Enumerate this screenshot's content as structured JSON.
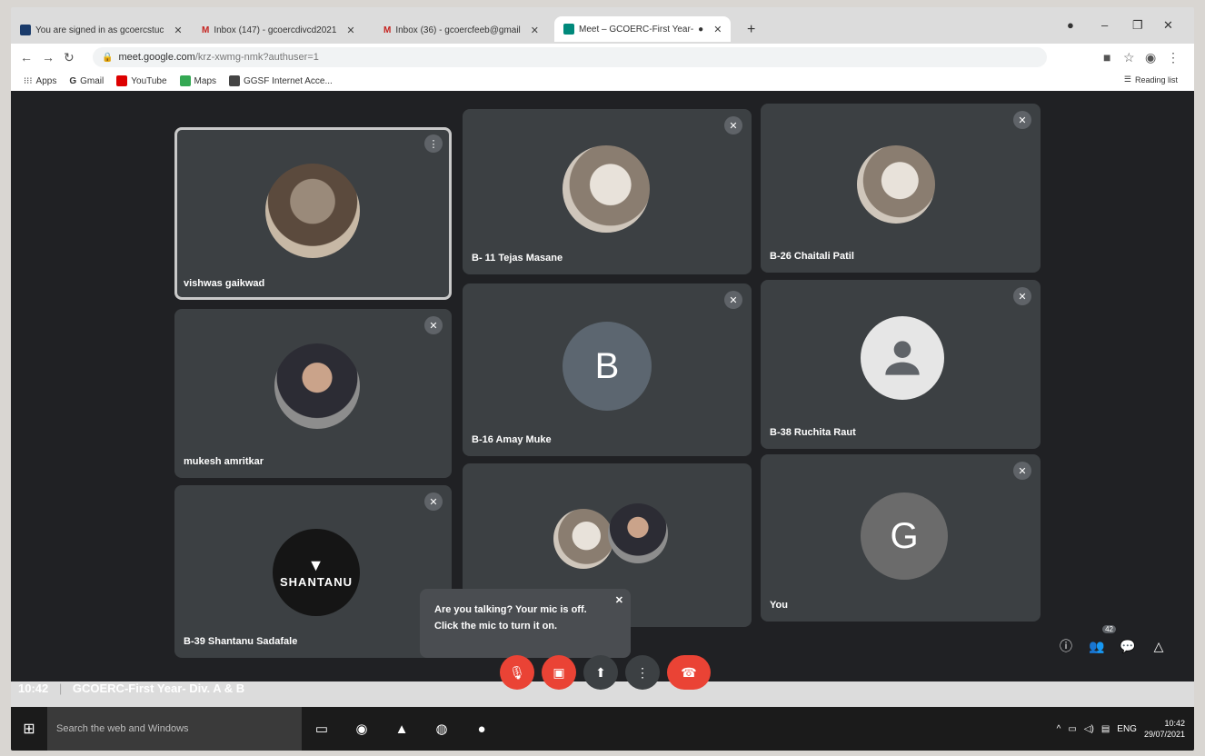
{
  "tabs": [
    {
      "label": "You are signed in as gcoercstuc",
      "active": false
    },
    {
      "label": "Inbox (147) - gcoercdivcd2021",
      "active": false
    },
    {
      "label": "Inbox (36) - gcoercfeeb@gmail",
      "active": false
    },
    {
      "label": "Meet – GCOERC-First Year-",
      "active": true
    }
  ],
  "new_tab": "+",
  "address": {
    "host": "meet.google.com",
    "path": "/krz-xwmg-nmk?authuser=1"
  },
  "bookmarks": [
    {
      "label": "Apps",
      "icon": "apps-grid-icon"
    },
    {
      "label": "Gmail",
      "icon": "google-g-icon"
    },
    {
      "label": "YouTube",
      "icon": "youtube-icon"
    },
    {
      "label": "Maps",
      "icon": "maps-icon"
    },
    {
      "label": "GGSF Internet Acce...",
      "icon": "bookmark-site-icon"
    }
  ],
  "reading_list": "Reading list",
  "participants": [
    {
      "name": "vishwas gaikwad",
      "avatar": "photo",
      "speaking": true
    },
    {
      "name": "B- 11 Tejas Masane",
      "avatar": "cat"
    },
    {
      "name": "B-26 Chaitali Patil",
      "avatar": "cat"
    },
    {
      "name": "mukesh amritkar",
      "avatar": "suit"
    },
    {
      "name": "B-16 Amay Muke",
      "avatar": "initial",
      "initial": "B"
    },
    {
      "name": "B-38 Ruchita Raut",
      "avatar": "person"
    },
    {
      "name": "B-39 Shantanu Sadafale",
      "avatar": "logo",
      "logo_text": "SHANTANU"
    },
    {
      "name": "",
      "avatar": "pair"
    },
    {
      "name": "You",
      "avatar": "initial",
      "initial": "G"
    }
  ],
  "tooltip": {
    "line1": "Are you talking? Your mic is off.",
    "line2": "Click the mic to turn it on."
  },
  "meeting": {
    "time": "10:42",
    "title": "GCOERC-First Year- Div. A & B"
  },
  "people_count": "42",
  "taskbar": {
    "search": "Search the web and Windows",
    "lang": "ENG",
    "time": "10:42",
    "date": "29/07/2021"
  },
  "colors": {
    "meet_bg": "#202124",
    "tile_bg": "#3c4043",
    "red": "#ea4335"
  }
}
